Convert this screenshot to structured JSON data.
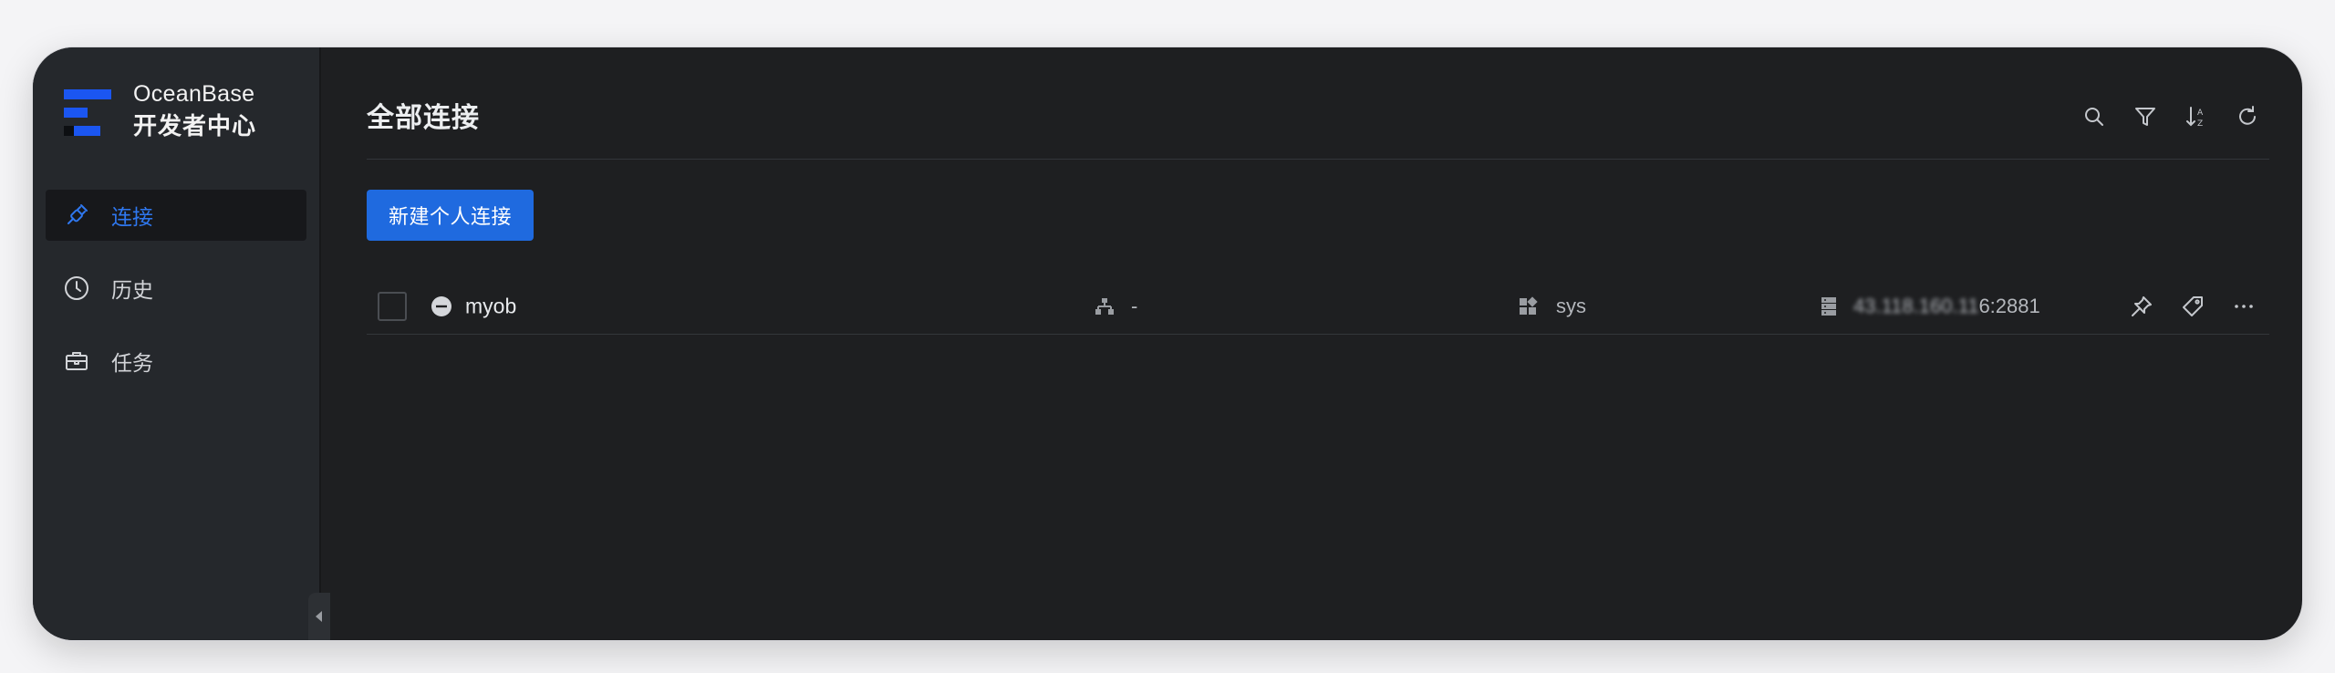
{
  "brand": {
    "line1": "OceanBase",
    "line2": "开发者中心"
  },
  "sidebar": {
    "items": [
      {
        "label": "连接",
        "icon": "plug-icon",
        "active": true
      },
      {
        "label": "历史",
        "icon": "clock-icon",
        "active": false
      },
      {
        "label": "任务",
        "icon": "briefcase-icon",
        "active": false
      }
    ]
  },
  "header": {
    "title": "全部连接",
    "tools": [
      "search-icon",
      "filter-icon",
      "sort-az-icon",
      "refresh-icon"
    ]
  },
  "actions": {
    "new_connection_label": "新建个人连接"
  },
  "connections": [
    {
      "name": "myob",
      "status": "disabled",
      "cluster": "-",
      "tenant": "sys",
      "host_masked": "43.118.160.11",
      "host_suffix": "6:2881"
    }
  ],
  "colors": {
    "accent": "#1f6adf",
    "brand_logo": "#1b56f1",
    "active_nav_text": "#2f78f0",
    "background": "#1e1f21",
    "sidebar": "#25282c"
  }
}
